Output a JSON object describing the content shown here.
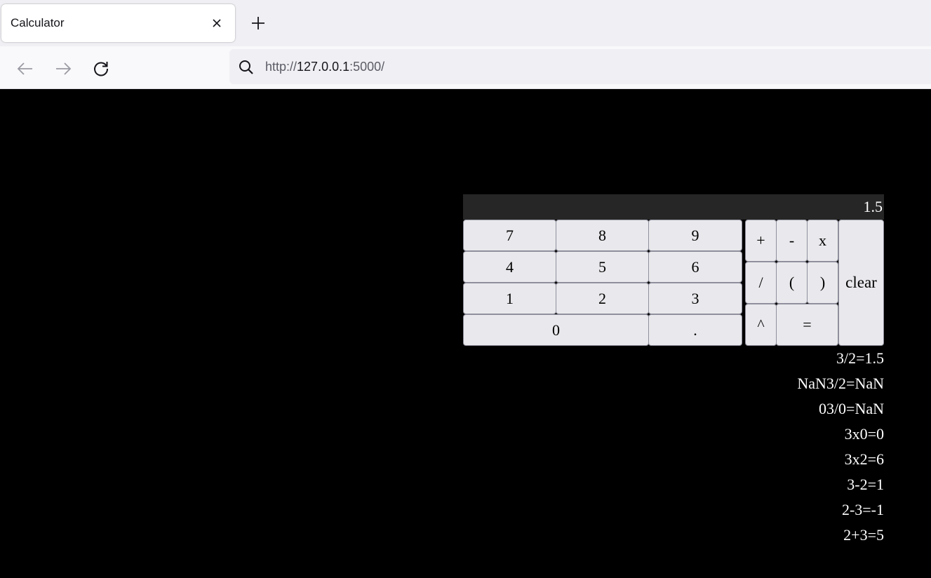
{
  "browser": {
    "tab_title": "Calculator",
    "url_prefix": "http://",
    "url_host": "127.0.0.1",
    "url_suffix": ":5000/",
    "icons": [
      "close-icon",
      "plus-icon",
      "back-arrow-icon",
      "forward-arrow-icon",
      "reload-icon",
      "search-icon"
    ]
  },
  "calculator": {
    "display_value": "1.5",
    "keys": {
      "k7": "7",
      "k8": "8",
      "k9": "9",
      "k4": "4",
      "k5": "5",
      "k6": "6",
      "k1": "1",
      "k2": "2",
      "k3": "3",
      "k0": "0",
      "kdot": ".",
      "plus": "+",
      "minus": "-",
      "times": "x",
      "divide": "/",
      "lparen": "(",
      "rparen": ")",
      "power": "^",
      "equals": "=",
      "clear": "clear"
    },
    "history": [
      "3/2=1.5",
      "NaN3/2=NaN",
      "03/0=NaN",
      "3x0=0",
      "3x2=6",
      "3-2=1",
      "2-3=-1",
      "2+3=5"
    ]
  },
  "colors": {
    "page_background": "#000000",
    "display_background": "#262626",
    "key_background": "#e9e9ed",
    "text_on_dark": "#ffffff"
  }
}
